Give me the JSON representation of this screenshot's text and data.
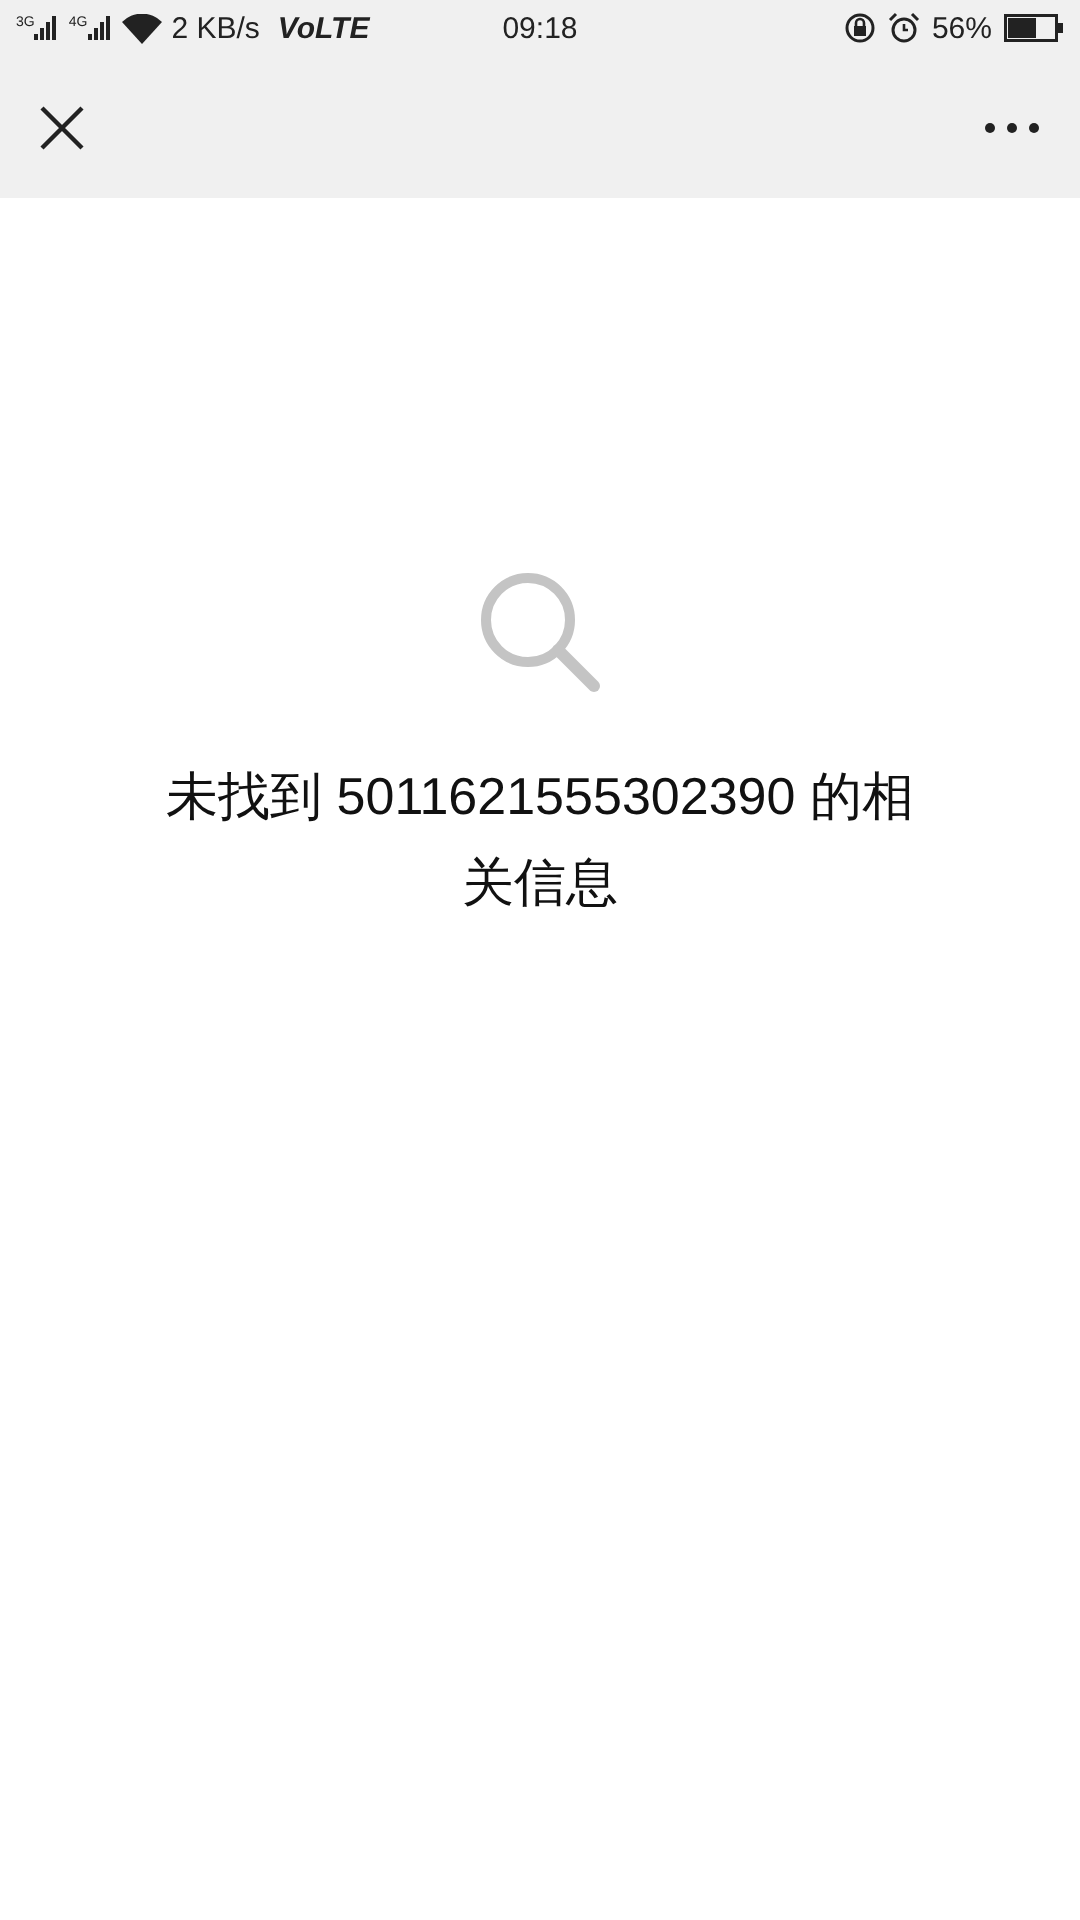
{
  "status_bar": {
    "sim1": "3G",
    "sim2": "4G",
    "speed": "2 KB/s",
    "volte": "VoLTE",
    "time": "09:18",
    "battery": "56%"
  },
  "message": {
    "line1": "未找到 5011621555302390 的相",
    "line2": "关信息"
  }
}
